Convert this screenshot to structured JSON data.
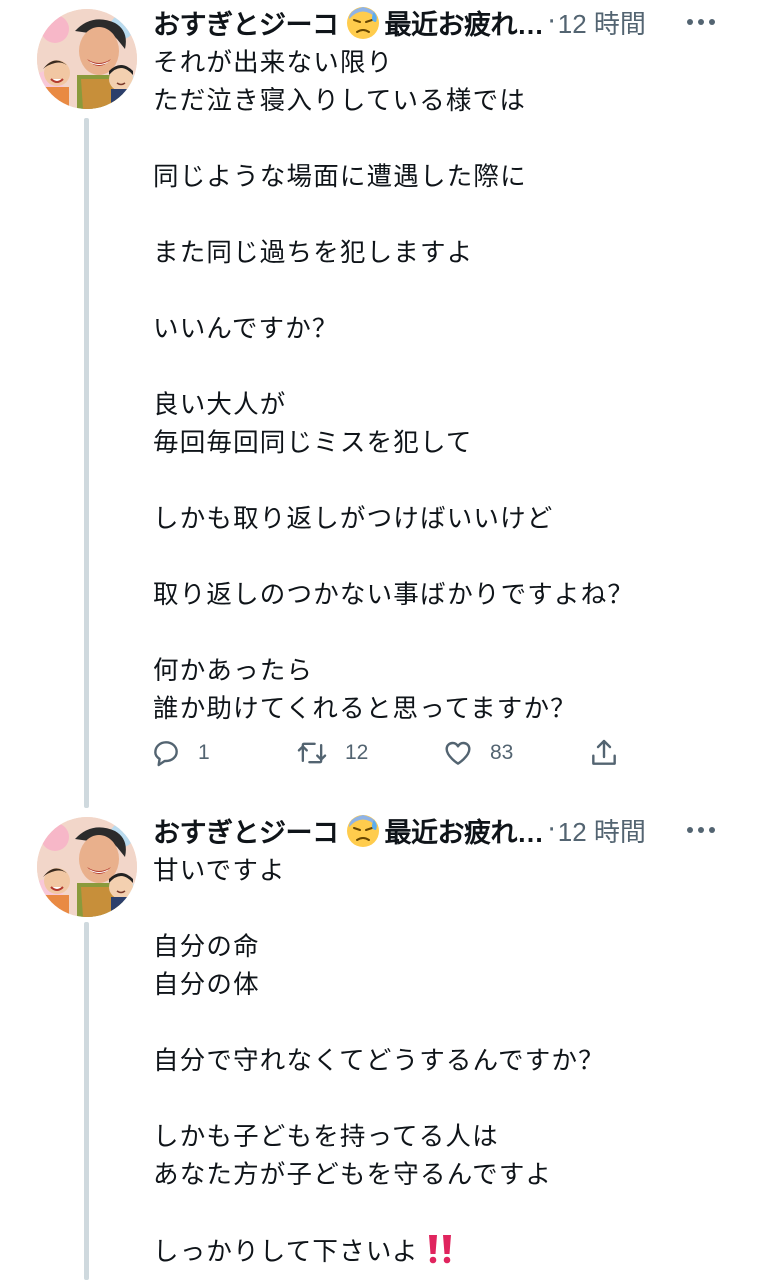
{
  "tweets": [
    {
      "author": {
        "display_name": "おすぎとジーコ",
        "name_emoji": "downcast-face-with-sweat-emoji",
        "name_suffix": "最近お疲れ…",
        "separator": "·",
        "time": "12 時間"
      },
      "body": {
        "p1": [
          "それが出来ない限り",
          "ただ泣き寝入りしている様では"
        ],
        "p2": [
          "同じような場面に遭遇した際に"
        ],
        "p3": [
          "また同じ過ちを犯しますよ"
        ],
        "p4": [
          "いいんですか？"
        ],
        "p5": [
          "良い大人が",
          "毎回毎回同じミスを犯して"
        ],
        "p6": [
          "しかも取り返しがつけばいいけど"
        ],
        "p7": [
          "取り返しのつかない事ばかりですよね？"
        ],
        "p8": [
          "何かあったら",
          "誰か助けてくれると思ってますか？"
        ]
      },
      "actions": {
        "reply_count": "1",
        "retweet_count": "12",
        "like_count": "83"
      }
    },
    {
      "author": {
        "display_name": "おすぎとジーコ",
        "name_emoji": "downcast-face-with-sweat-emoji",
        "name_suffix": "最近お疲れ…",
        "separator": "·",
        "time": "12 時間"
      },
      "body": {
        "p1": [
          "甘いですよ"
        ],
        "p2": [
          "自分の命",
          "自分の体"
        ],
        "p3": [
          "自分で守れなくてどうするんですか？"
        ],
        "p4": [
          "しかも子どもを持ってる人は",
          "あなた方が子どもを守るんですよ"
        ],
        "p5": [
          "しっかりして下さいよ"
        ],
        "p5_emoji": "double-exclamation-emoji"
      }
    }
  ],
  "colors": {
    "text": "#0f1419",
    "secondary": "#536471",
    "thread_line": "#cfd9de",
    "alert_red": "#e0245e"
  }
}
